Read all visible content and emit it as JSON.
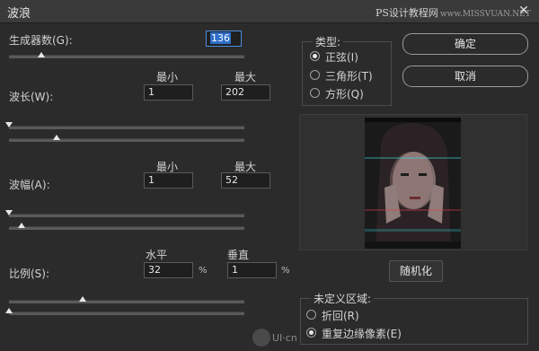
{
  "window": {
    "title": "波浪",
    "close_glyph": "✕",
    "watermark": "PS设计教程网",
    "watermark_en": "www.MISSVUAN.NET"
  },
  "generators": {
    "label": "生成器数(G):",
    "value": "136",
    "slider_fraction": 0.14
  },
  "wavelength": {
    "label": "波长(W):",
    "min_header": "最小",
    "max_header": "最大",
    "min": "1",
    "max": "202",
    "min_fraction": 0.0,
    "max_fraction": 0.2
  },
  "amplitude": {
    "label": "波幅(A):",
    "min_header": "最小",
    "max_header": "最大",
    "min": "1",
    "max": "52",
    "min_fraction": 0.0,
    "max_fraction": 0.05
  },
  "scale": {
    "label": "比例(S):",
    "h_header": "水平",
    "v_header": "垂直",
    "horizontal": "32",
    "vertical": "1",
    "unit": "%",
    "h_fraction": 0.31,
    "v_fraction": 0.0
  },
  "type_group": {
    "legend": "类型:",
    "options": [
      "正弦(I)",
      "三角形(T)",
      "方形(Q)"
    ],
    "selected": 0
  },
  "buttons": {
    "ok": "确定",
    "cancel": "取消",
    "randomize": "随机化"
  },
  "undefined_area": {
    "legend": "未定义区域:",
    "options": [
      "折回(R)",
      "重复边缘像素(E)"
    ],
    "selected": 1
  },
  "footer": {
    "watermark": "UI·cn"
  }
}
